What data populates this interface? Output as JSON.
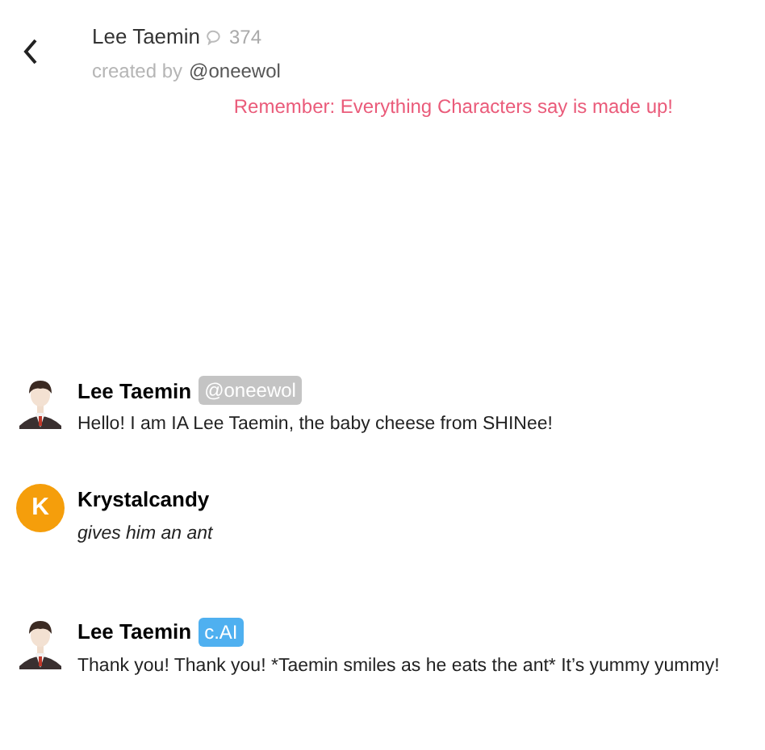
{
  "header": {
    "title": "Lee Taemin",
    "chat_count": "374",
    "creator_prefix": "created by",
    "creator": "@oneewol"
  },
  "notice": "Remember: Everything Characters say is made up!",
  "messages": [
    {
      "name": "Lee Taemin",
      "badge": {
        "kind": "creator",
        "text": "@oneewol"
      },
      "text": "Hello! I am IA Lee Taemin, the baby cheese from SHINee!",
      "kind": "character"
    },
    {
      "avatar": {
        "kind": "letter",
        "letter": "K",
        "color": "#f59e0b"
      },
      "name": "Krystalcandy",
      "text": "gives him an ant",
      "kind": "user"
    },
    {
      "name": "Lee Taemin",
      "badge": {
        "kind": "ai",
        "text": "c.AI"
      },
      "text": "Thank you! Thank you! *Taemin smiles as he eats the ant* It’s yummy yummy!",
      "kind": "character"
    }
  ]
}
